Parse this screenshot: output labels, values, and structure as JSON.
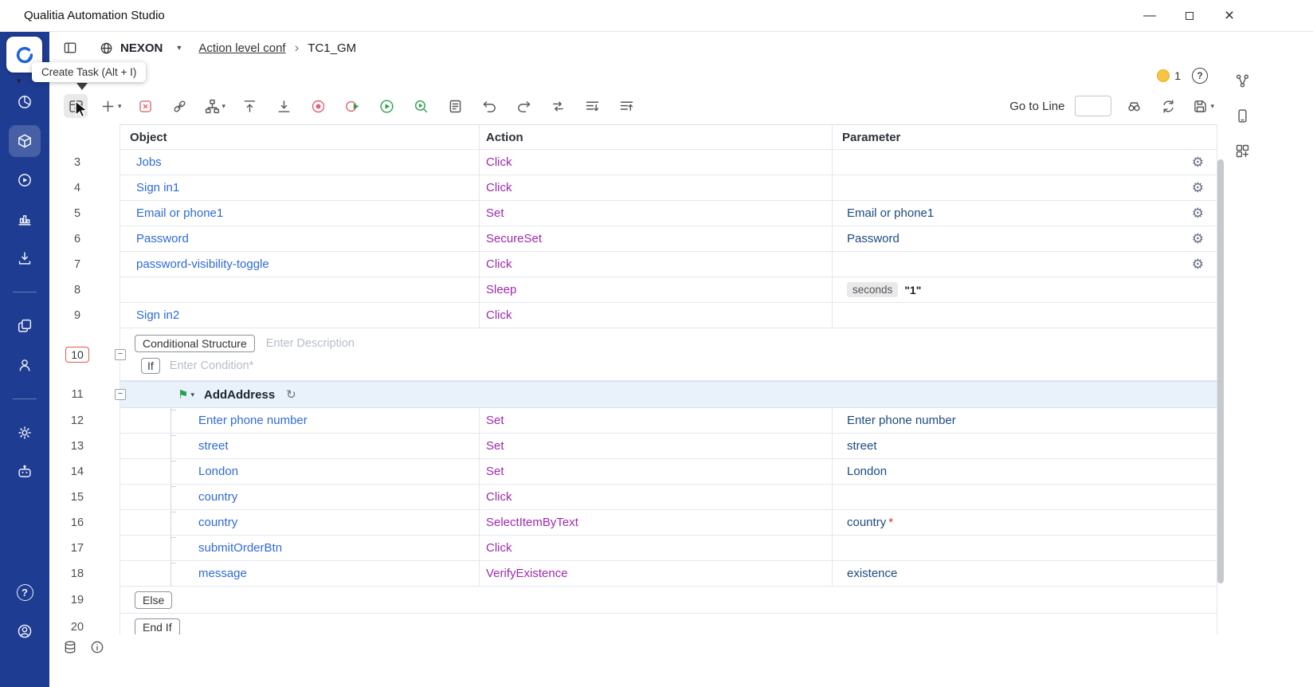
{
  "titlebar": {
    "title": "Qualitia Automation Studio"
  },
  "header": {
    "project": "NEXON",
    "breadcrumb_parent": "Action level conf",
    "breadcrumb_separator": "›",
    "breadcrumb_current": "TC1_GM",
    "coin_count": "1"
  },
  "tooltip": {
    "text": "Create Task (Alt + I)"
  },
  "toolbar": {
    "go_to_line_label": "Go to Line",
    "go_to_line_value": "",
    "items": [
      {
        "icon": "insert-task-icon",
        "pressed": true
      },
      {
        "icon": "add-step-icon",
        "caret": true
      },
      {
        "icon": "delete-step-icon"
      },
      {
        "icon": "link-object-icon"
      },
      {
        "icon": "branch-structure-icon",
        "caret": true
      },
      {
        "icon": "move-top-icon"
      },
      {
        "icon": "move-bottom-icon"
      },
      {
        "icon": "record-icon"
      },
      {
        "icon": "record-play-icon"
      },
      {
        "icon": "run-icon"
      },
      {
        "icon": "debug-run-icon"
      },
      {
        "icon": "steps-list-icon"
      },
      {
        "icon": "undo-icon"
      },
      {
        "icon": "redo-icon"
      },
      {
        "icon": "reorder-icon"
      },
      {
        "icon": "collapse-all-icon"
      },
      {
        "icon": "expand-all-icon"
      }
    ]
  },
  "sidebar": {
    "items": [
      {
        "name": "dashboard",
        "icon": "pie-chart-icon"
      },
      {
        "name": "develop",
        "icon": "modules-icon",
        "active": true
      },
      {
        "name": "execute",
        "icon": "play-circle-icon"
      },
      {
        "name": "reports",
        "icon": "bar-chart-icon"
      },
      {
        "name": "downloads",
        "icon": "download-icon"
      },
      {
        "name": "repository",
        "icon": "repository-icon",
        "divider_before": true
      },
      {
        "name": "users",
        "icon": "user-icon"
      },
      {
        "name": "settings",
        "icon": "gear-icon",
        "divider_before": true
      },
      {
        "name": "bot",
        "icon": "bot-icon"
      }
    ],
    "bottom_items": [
      {
        "name": "help",
        "icon": "help-icon"
      },
      {
        "name": "profile",
        "icon": "profile-icon"
      }
    ]
  },
  "right_rail": {
    "items": [
      {
        "name": "object-map",
        "icon": "object-map-icon"
      },
      {
        "name": "mobile-device",
        "icon": "mobile-device-icon"
      },
      {
        "name": "add-widget",
        "icon": "add-widget-icon"
      }
    ]
  },
  "statusbar": {
    "items": [
      {
        "name": "datastore",
        "icon": "datastore-icon"
      },
      {
        "name": "info",
        "icon": "info-icon"
      }
    ]
  },
  "grid": {
    "columns": [
      "Object",
      "Action",
      "Parameter"
    ],
    "rows": [
      {
        "type": "step",
        "num": "3",
        "object": "Jobs",
        "action": "Click",
        "parameter": "",
        "gear": true
      },
      {
        "type": "step",
        "num": "4",
        "object": "Sign in1",
        "action": "Click",
        "parameter": "",
        "gear": true
      },
      {
        "type": "step",
        "num": "5",
        "object": "Email or phone1",
        "action": "Set",
        "parameter": "Email or phone1",
        "gear": true
      },
      {
        "type": "step",
        "num": "6",
        "object": "Password",
        "action": "SecureSet",
        "parameter": "Password",
        "gear": true
      },
      {
        "type": "step",
        "num": "7",
        "object": "password-visibility-toggle",
        "action": "Click",
        "parameter": "",
        "gear": true
      },
      {
        "type": "step",
        "num": "8",
        "object": "",
        "action": "Sleep",
        "param_chip": {
          "label": "seconds",
          "value": "\"1\""
        }
      },
      {
        "type": "step",
        "num": "9",
        "object": "Sign in2",
        "action": "Click",
        "parameter": ""
      },
      {
        "type": "conditional",
        "num": "10",
        "chip_label": "Conditional Structure",
        "description_placeholder": "Enter Description",
        "if_label": "If",
        "condition_placeholder": "Enter Condition*"
      },
      {
        "type": "task",
        "num": "11",
        "label": "AddAddress"
      },
      {
        "type": "nested",
        "num": "12",
        "object": "Enter phone number",
        "action": "Set",
        "parameter": "Enter phone number"
      },
      {
        "type": "nested",
        "num": "13",
        "object": "street",
        "action": "Set",
        "parameter": "street"
      },
      {
        "type": "nested",
        "num": "14",
        "object": "London",
        "action": "Set",
        "parameter": "London"
      },
      {
        "type": "nested",
        "num": "15",
        "object": "country",
        "action": "Click",
        "parameter": ""
      },
      {
        "type": "nested",
        "num": "16",
        "object": "country",
        "action": "SelectItemByText",
        "parameter": "country",
        "required": true,
        "required_mark": "*"
      },
      {
        "type": "nested",
        "num": "17",
        "object": "submitOrderBtn",
        "action": "Click",
        "parameter": ""
      },
      {
        "type": "nested",
        "num": "18",
        "object": "message",
        "action": "VerifyExistence",
        "parameter": "existence"
      },
      {
        "type": "chip",
        "num": "19",
        "chip_label": "Else"
      },
      {
        "type": "chip",
        "num": "20",
        "chip_label": "End If"
      }
    ]
  },
  "glyphs": {
    "gear": "⚙",
    "flag": "⚑",
    "loop": "↻",
    "caret_down": "▾",
    "minus": "−",
    "help": "?",
    "minimize": "—",
    "close": "×"
  },
  "colors": {
    "sidebar_bg": "#1e3c92",
    "object_text": "#2e6bd6",
    "action_text": "#9c2bad",
    "parameter_text": "#1c4b82",
    "task_row_bg": "#e9f2fb",
    "conditional_number_border": "#e2574b",
    "run_green": "#2f9e4f",
    "record_red": "#e0607a",
    "coin_yellow": "#f6c344"
  }
}
